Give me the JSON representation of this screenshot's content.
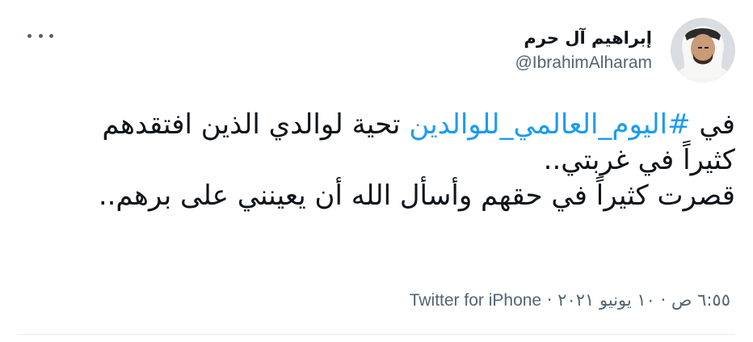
{
  "author": {
    "display_name": "إبراهيم آل حرم",
    "handle": "@IbrahimAlharam",
    "avatar_icon": "person-avatar-icon"
  },
  "tweet": {
    "text_before": "في ",
    "hashtag": "#اليوم_العالمي_للوالدين",
    "text_after": " تحية لوالدي الذين افتقدهم كثيراً في غربتي..\nقصرت كثيراً في حقهم وأسأل الله أن يعينني على برهم..",
    "time": "٦:٥٥ ص",
    "separator": "·",
    "date": "١٠ يونيو ٢٠٢١",
    "source": "Twitter for iPhone"
  },
  "colors": {
    "accent": "#1d9bf0",
    "secondary_text": "#536471",
    "divider": "#e6ecf0"
  }
}
